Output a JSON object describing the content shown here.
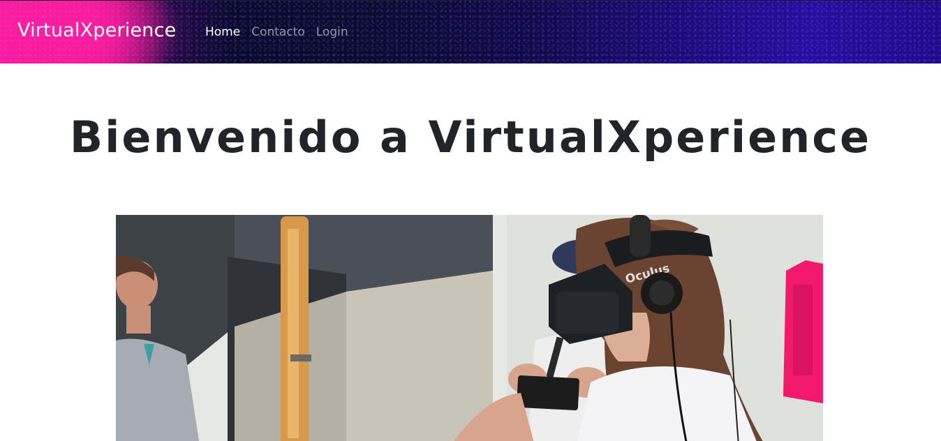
{
  "navbar": {
    "brand": "VirtualXperience",
    "links": [
      {
        "label": "Home",
        "active": true
      },
      {
        "label": "Contacto",
        "active": false
      },
      {
        "label": "Login",
        "active": false
      }
    ]
  },
  "hero": {
    "title": "Bienvenido a VirtualXperience",
    "image": {
      "headset_brand": "Oculus"
    }
  },
  "colors": {
    "title_text": "#212529",
    "nav_active": "#ffffff",
    "nav_inactive": "rgba(255,255,255,0.55)",
    "navbar_pink": "#ff1aa0",
    "navbar_purple": "#2a0ca0"
  }
}
